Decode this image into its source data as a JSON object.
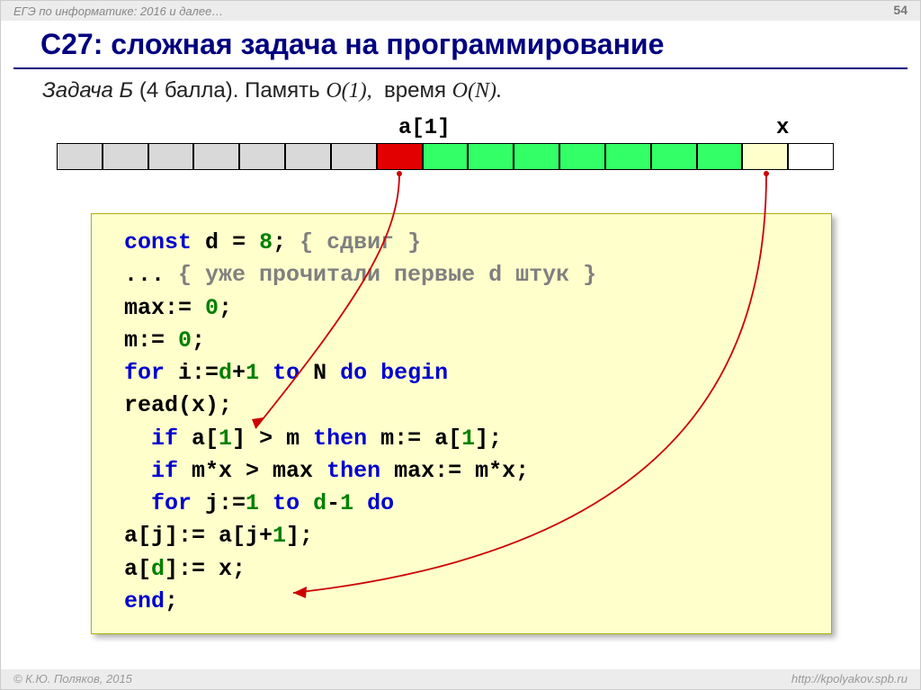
{
  "header": {
    "context": "ЕГЭ по информатике: 2016 и далее…",
    "page": "54"
  },
  "title": "C27: сложная задача на программирование",
  "subtitle": {
    "task_em": "Задача Б",
    "points": "(4 балла).",
    "mem_word": "Память",
    "mem_big": "O(1),",
    "time_word": "время",
    "time_big": "O(N)."
  },
  "labels": {
    "a1": "a[1]",
    "x": "x"
  },
  "tape": [
    "gray",
    "gray",
    "gray",
    "gray",
    "gray",
    "gray",
    "gray",
    "red",
    "green",
    "green",
    "green",
    "green",
    "green",
    "green",
    "green",
    "yellow",
    "white"
  ],
  "code": {
    "l1_const": "const",
    "l1_d": "d",
    "l1_eq": "=",
    "l1_8": "8",
    "l1_sc": ";",
    "l1_cm": "{ сдвиг }",
    "l2_dots": "... ",
    "l2_cm": "{ уже прочитали первые d штук }",
    "l3": "max:= ",
    "l3_0": "0",
    "l3_sc": ";",
    "l4": "m:= ",
    "l4_0": "0",
    "l4_sc": ";",
    "l5_for": "for",
    "l5_i": " i:=",
    "l5_d": "d",
    "l5_p": "+",
    "l5_1": "1",
    "l5_to": "to",
    "l5_n": " N ",
    "l5_do": "do begin",
    "l6": "  read(x);",
    "l7_if": "if",
    "l7_a1": " a[",
    "l7_1a": "1",
    "l7_b": "] > m ",
    "l7_then": "then",
    "l7_assign": " m:= a[",
    "l7_1b": "1",
    "l7_end": "];",
    "l8_if": "if",
    "l8_mx": " m*x > max ",
    "l8_then": "then",
    "l8_assign": " max:= m*x;",
    "l9_for": "for",
    "l9_j": " j:=",
    "l9_1": "1",
    "l9_to": "to",
    "l9_d": "d",
    "l9_m": "-",
    "l9_1b": "1",
    "l9_do": "do",
    "l10_pre": "    a[j]:= a[j+",
    "l10_1": "1",
    "l10_post": "];",
    "l11": "  a[",
    "l11_d": "d",
    "l11_post": "]:= x;",
    "l12_end": "end",
    "l12_sc": ";"
  },
  "footer": {
    "left": "© К.Ю. Поляков, 2015",
    "right": "http://kpolyakov.spb.ru"
  }
}
